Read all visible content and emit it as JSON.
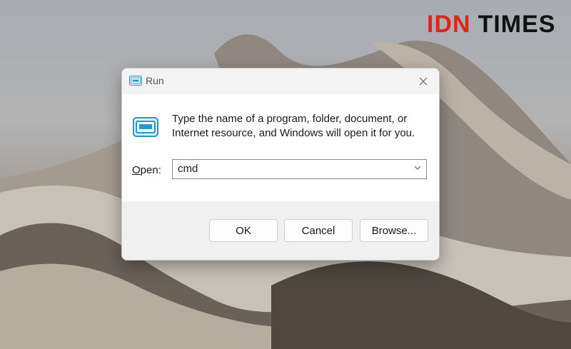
{
  "watermark": {
    "part1": "IDN",
    "part2": "TIMES"
  },
  "dialog": {
    "title": "Run",
    "description": "Type the name of a program, folder, document, or Internet resource, and Windows will open it for you.",
    "open_label_underlined": "O",
    "open_label_rest": "pen:",
    "open_value": "cmd",
    "buttons": {
      "ok": "OK",
      "cancel": "Cancel",
      "browse": "Browse..."
    }
  },
  "icons": {
    "title": "run-icon",
    "content": "run-icon",
    "close": "close-icon",
    "dropdown": "chevron-down-icon"
  },
  "colors": {
    "brand_red": "#e2231a",
    "accent_blue": "#1e9bd7"
  }
}
